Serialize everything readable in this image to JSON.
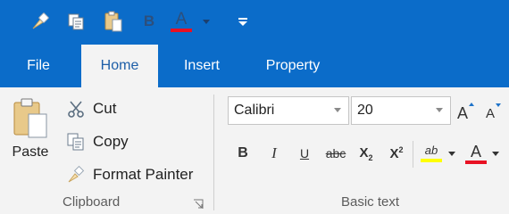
{
  "quick_access": {
    "items": [
      {
        "name": "format-painter-icon"
      },
      {
        "name": "copy-icon"
      },
      {
        "name": "paste-icon"
      },
      {
        "name": "bold-icon",
        "glyph": "B"
      },
      {
        "name": "font-color-icon",
        "glyph": "A"
      },
      {
        "name": "customize-toolbar-icon"
      }
    ],
    "bold_glyph": "B",
    "font_color_glyph": "A"
  },
  "tabs": [
    {
      "label": "File"
    },
    {
      "label": "Home"
    },
    {
      "label": "Insert"
    },
    {
      "label": "Property"
    }
  ],
  "clipboard": {
    "paste_label": "Paste",
    "cut_label": "Cut",
    "copy_label": "Copy",
    "format_painter_label": "Format Painter",
    "group_label": "Clipboard"
  },
  "basic_text": {
    "font_name": "Calibri",
    "font_size": "20",
    "group_label": "Basic text",
    "grow_glyph": "A",
    "shrink_glyph": "A",
    "bold_glyph": "B",
    "italic_glyph": "I",
    "underline_glyph": "U",
    "strike_glyph": "abc",
    "subscript_glyph": "X",
    "superscript_glyph": "X",
    "highlight_glyph": "ab",
    "font_color_glyph": "A"
  },
  "colors": {
    "accent": "#0b6cc9",
    "font_color_bar": "#e81123",
    "highlight_bar": "#ffff00",
    "active_tab_text": "#1e5fa8"
  }
}
